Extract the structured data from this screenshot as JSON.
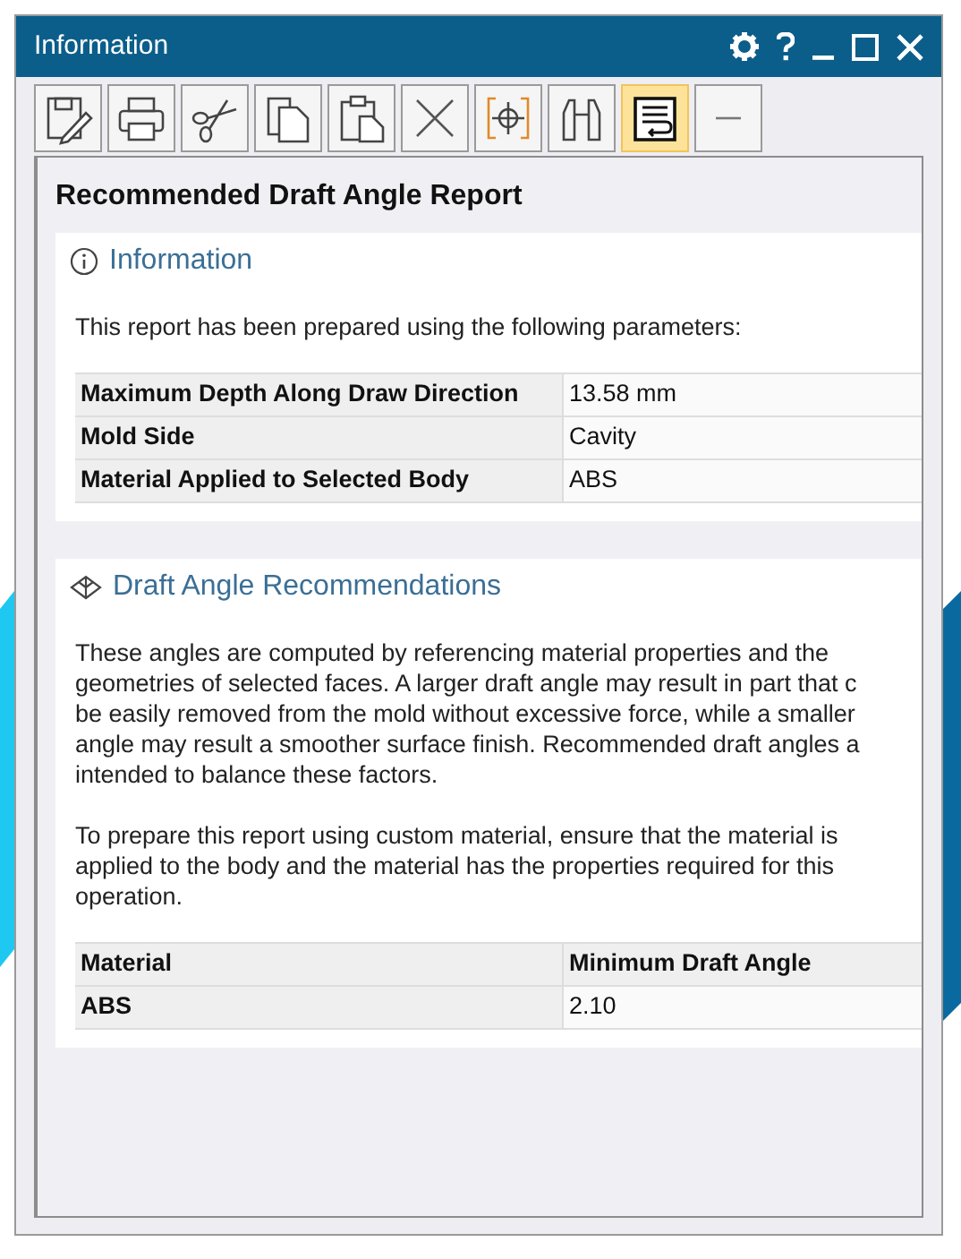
{
  "window": {
    "title": "Information"
  },
  "toolbar": [
    {
      "pressed": false
    },
    {
      "pressed": false
    },
    {
      "pressed": false
    },
    {
      "pressed": false
    },
    {
      "pressed": false
    },
    {
      "pressed": false
    },
    {
      "pressed": false
    },
    {
      "pressed": false
    },
    {
      "pressed": true
    },
    {
      "pressed": false
    }
  ],
  "report": {
    "title": "Recommended Draft Angle Report",
    "sections": [
      {
        "kind": "info",
        "heading": "Information",
        "paragraphs": [
          [
            "This report has been prepared using the following parameters:"
          ]
        ],
        "table": {
          "header": false,
          "rows": [
            [
              "Maximum Depth Along Draw Direction",
              "13.58 mm"
            ],
            [
              "Mold Side",
              "Cavity"
            ],
            [
              "Material Applied to Selected Body",
              "ABS"
            ]
          ]
        }
      },
      {
        "kind": "draft",
        "heading": "Draft Angle Recommendations",
        "paragraphs": [
          [
            "These angles are computed by referencing material properties and the",
            "geometries of selected faces. A larger draft angle may result in part that c",
            "be easily removed from the mold without excessive force, while a smaller",
            "angle may result a smoother surface finish. Recommended draft angles a",
            "intended to balance these factors."
          ],
          [
            "To prepare this report using custom material, ensure that the material is",
            "applied to the body and the material has the properties required for this",
            "operation."
          ]
        ],
        "table": {
          "header": true,
          "rows": [
            [
              "Material",
              "Minimum Draft Angle"
            ],
            [
              "ABS",
              "2.10"
            ]
          ]
        }
      }
    ]
  }
}
